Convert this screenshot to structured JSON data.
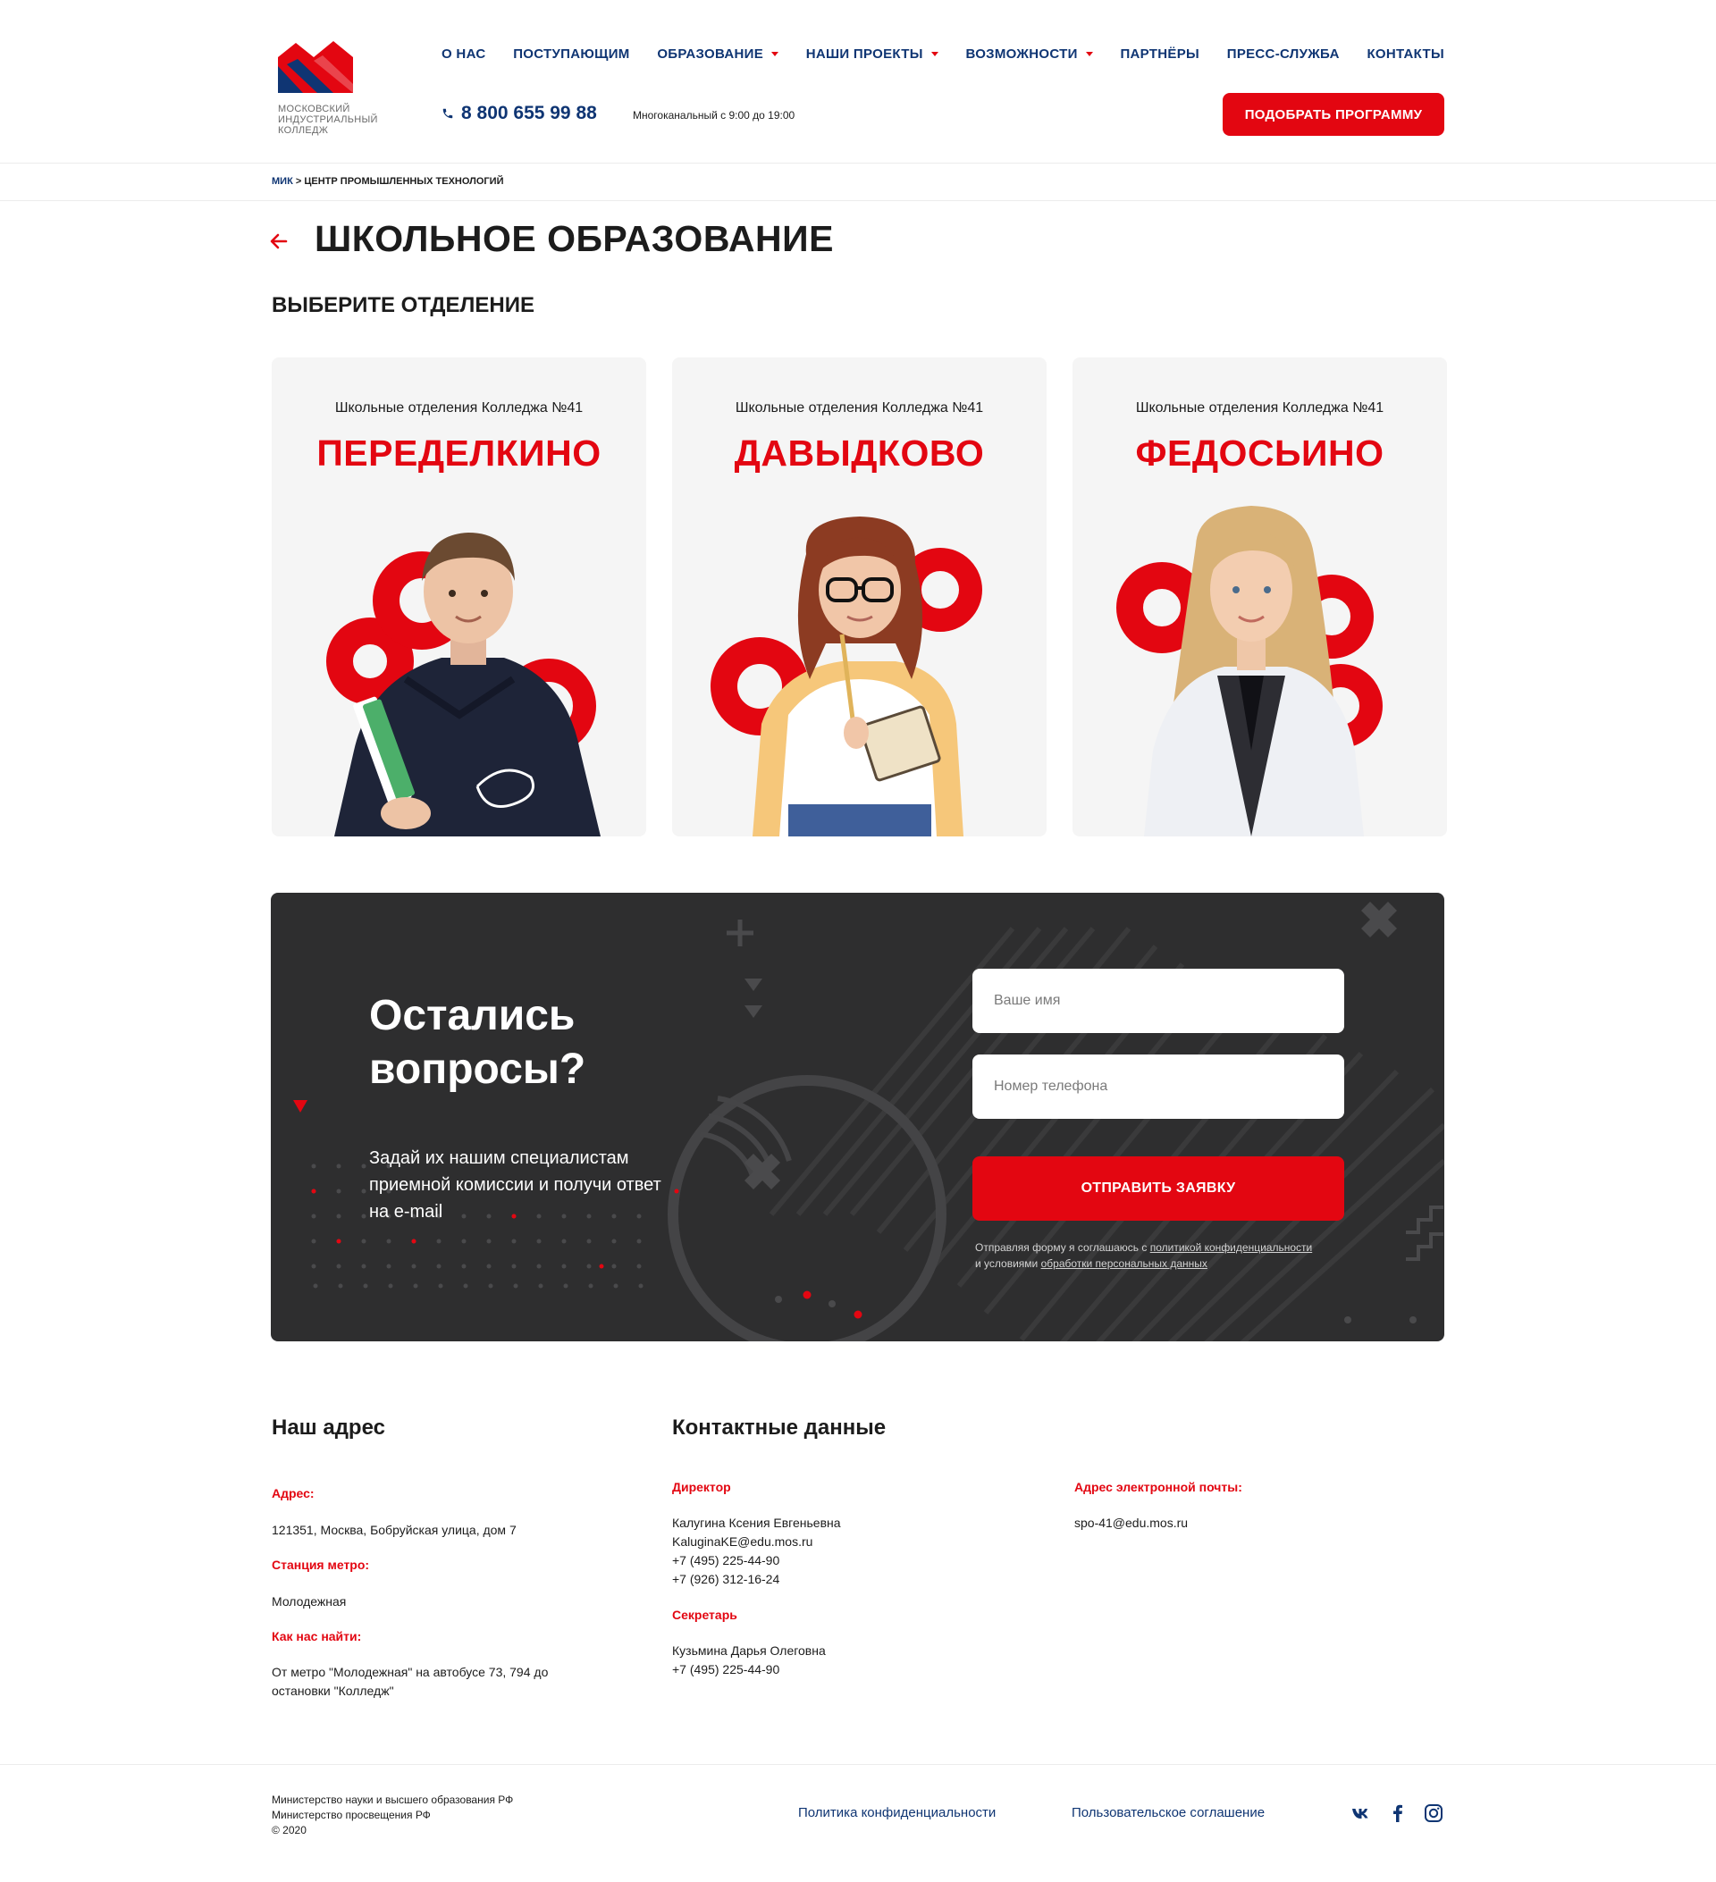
{
  "header": {
    "logo_text": "Московский индустриальный колледж",
    "nav": [
      "О нас",
      "Поступающим",
      "Образование",
      "Наши проекты",
      "Возможности",
      "Партнёры",
      "Пресс-служба",
      "Контакты"
    ],
    "phone": "8 800 655 99 88",
    "phone_hours": "Многоканальный с 9:00 до 19:00",
    "cta": "Подобрать программу"
  },
  "breadcrumb": {
    "home": "МИК",
    "separator": ">",
    "current": "Центр промышленных технологий"
  },
  "page": {
    "title": "Школьное образование",
    "section_title": "Выберите отделение"
  },
  "departments": [
    {
      "subtitle": "Школьные отделения Колледжа №41",
      "name": "Переделкино"
    },
    {
      "subtitle": "Школьные отделения Колледжа №41",
      "name": "Давыдково"
    },
    {
      "subtitle": "Школьные отделения Колледжа №41",
      "name": "Федосьино"
    }
  ],
  "question_form": {
    "title": "Остались вопросы?",
    "text": "Задай их нашим специалистам приемной комиссии и получи ответ на e-mail",
    "name_placeholder": "Ваше имя",
    "phone_placeholder": "Номер телефона",
    "submit": "Отправить заявку",
    "agree_prefix": "Отправляя форму я соглашаюсь с",
    "agree_link1": "политикой конфиденциальности",
    "agree_middle": "и условиями",
    "agree_link2": "обработки персональных данных"
  },
  "address": {
    "heading": "Наш адрес",
    "address_label": "Адрес:",
    "address_value": "121351, Москва, Бобруйская улица, дом 7",
    "metro_label": "Станция метро:",
    "metro_value": "Молодежная",
    "directions_label": "Как нас найти:",
    "directions_value": "От метро \"Молодежная\" на автобусе 73, 794 до остановки \"Колледж\""
  },
  "contacts": {
    "heading": "Контактные данные",
    "director_label": "Директор",
    "director_name": "Калугина Ксения Евгеньевна",
    "director_email": "KaluginaKE@edu.mos.ru",
    "director_phone1": "+7 (495) 225-44-90",
    "director_phone2": "+7 (926) 312-16-24",
    "secretary_label": "Секретарь",
    "secretary_name": "Кузьмина Дарья Олеговна",
    "secretary_phone": "+7 (495) 225-44-90",
    "email_label": "Адрес электронной почты:",
    "email_value": "spo-41@edu.mos.ru"
  },
  "footer": {
    "line1": "Министерство науки и высшего образования РФ",
    "line2": "Министерство просвещения РФ",
    "line3": "© 2020",
    "privacy": "Политика конфиденциальности",
    "agreement": "Пользовательское соглашение",
    "social_icons": [
      "vk-icon",
      "facebook-icon",
      "instagram-icon"
    ]
  },
  "colors": {
    "brand_red": "#e30611",
    "brand_blue": "#0f3573",
    "dark_block": "#2e2e2f",
    "card_bg": "#f5f5f5"
  }
}
